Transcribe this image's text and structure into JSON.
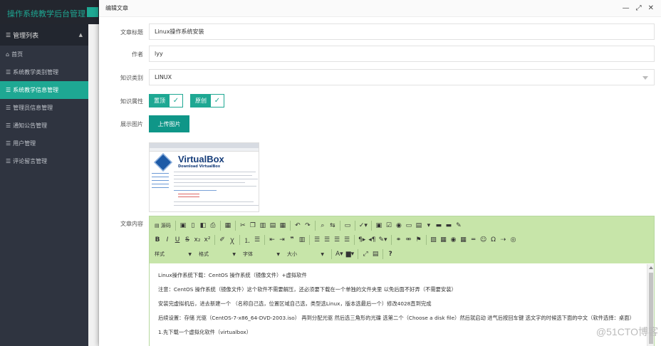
{
  "app": {
    "title": "操作系统教学后台管理"
  },
  "sidebar": {
    "group_label": "管理列表",
    "items": [
      {
        "label": "首页",
        "active": false
      },
      {
        "label": "系统教学类别管理",
        "active": false
      },
      {
        "label": "系统教学信息管理",
        "active": true
      },
      {
        "label": "管理员信息管理",
        "active": false
      },
      {
        "label": "通知公告管理",
        "active": false
      },
      {
        "label": "用户管理",
        "active": false
      },
      {
        "label": "评论留言管理",
        "active": false
      }
    ]
  },
  "dialog": {
    "title": "编辑文章",
    "actions": {
      "minimize": "—",
      "maximize": "⤢",
      "close": "✕"
    }
  },
  "form": {
    "title_label": "文章标题",
    "title_value": "Linux操作系统安装",
    "author_label": "作者",
    "author_value": "lyy",
    "category_label": "知识类别",
    "category_value": "LINUX",
    "attrs_label": "知识属性",
    "attrs": [
      {
        "label": "置顶",
        "checked": true
      },
      {
        "label": "原创",
        "checked": true
      }
    ],
    "image_label": "展示图片",
    "upload_label": "上传图片",
    "content_label": "文章内容",
    "thumbnail": {
      "title": "VirtualBox",
      "subtitle": "Download VirtualBox"
    }
  },
  "editor": {
    "toolbar_row1": [
      "源码",
      "保存",
      "新建",
      "预览",
      "打印",
      "模板",
      "剪切",
      "复制",
      "粘贴",
      "粘贴文本",
      "从Word粘贴",
      "撤销",
      "重做",
      "查找",
      "替换",
      "全选",
      "拼写检查",
      "表单",
      "复选框",
      "单选",
      "文本框",
      "多行文本",
      "下拉",
      "按钮",
      "图像按钮",
      "隐藏域"
    ],
    "source_label": "源码",
    "combos": [
      {
        "label": "样式"
      },
      {
        "label": "格式"
      },
      {
        "label": "字体"
      },
      {
        "label": "大小"
      }
    ],
    "paragraphs": [
      "Linux操作系统下载：CentOS 操作系统（镜像文件）+虚拟软件",
      "注意：CentOS 操作系统（镜像文件）这个软件不需要解压，还必须要下载在一个单独的文件夹里 以免后面不好弄（不需要安装）",
      "安装完虚拟机后，进去新建一个 （名称自己选，位置区域自己选，类型选Linux，版本选最后一个）修改4028直到完成",
      "后续设置：存储 光驱（CentOS-7-x86_64-DVD-2003.iso） 再到分配光驱 然后选三角形的光碟 选第二个（Choose a disk file）然后就启动 进气后按回车键 选文字的时候选下面的中文（软件选择：桌面）",
      "1.先下载一个虚拟化软件（virtualbox）"
    ]
  },
  "watermark": "@51CTO博客"
}
